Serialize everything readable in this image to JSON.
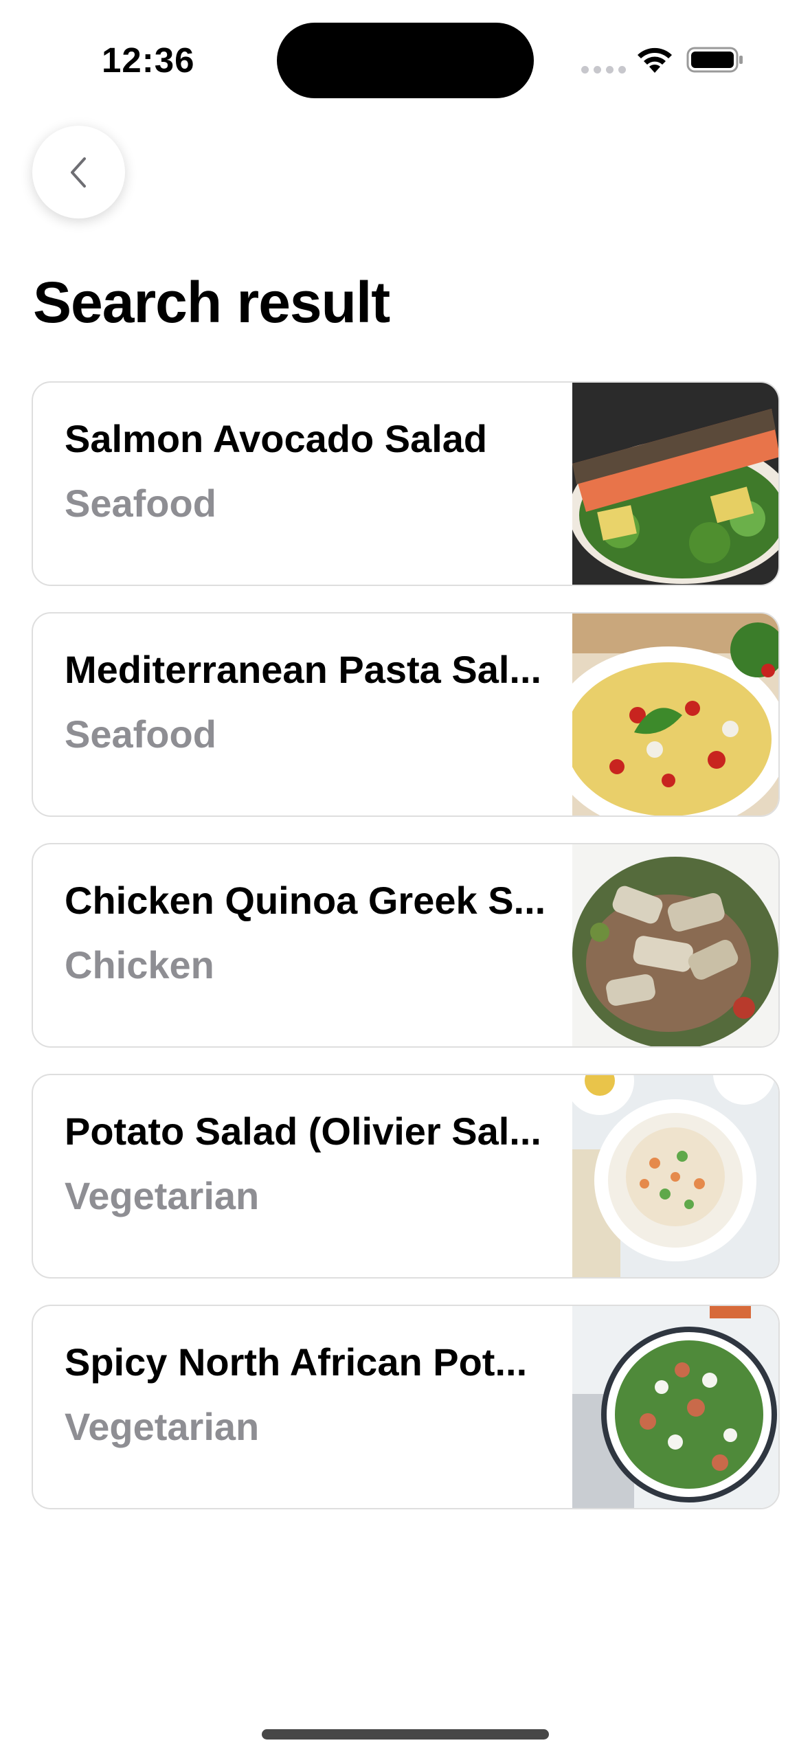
{
  "status_bar": {
    "time": "12:36",
    "icons": [
      "signal-icon",
      "wifi-icon",
      "battery-icon"
    ]
  },
  "header": {
    "back_icon": "chevron-left-icon",
    "title": "Search result"
  },
  "results": [
    {
      "title": "Salmon Avocado Salad",
      "category": "Seafood",
      "image": "salmon-salad-photo"
    },
    {
      "title": "Mediterranean Pasta Sal...",
      "category": "Seafood",
      "image": "pasta-salad-photo"
    },
    {
      "title": "Chicken Quinoa Greek S...",
      "category": "Chicken",
      "image": "chicken-quinoa-photo"
    },
    {
      "title": "Potato Salad (Olivier Sal...",
      "category": "Vegetarian",
      "image": "olivier-salad-photo"
    },
    {
      "title": "Spicy North African Pot...",
      "category": "Vegetarian",
      "image": "african-potato-salad-photo"
    }
  ],
  "colors": {
    "category_text": "#8e8e93",
    "card_border": "#dedede",
    "background": "#ffffff"
  }
}
